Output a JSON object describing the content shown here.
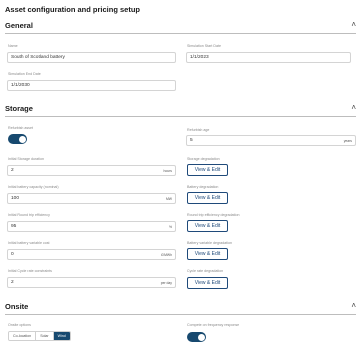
{
  "page": {
    "title": "Asset configuration and pricing setup"
  },
  "general": {
    "title": "General",
    "name_label": "Name",
    "name_value": "South of Scotland battery",
    "start_label": "Simulation Start Date",
    "start_value": "1/1/2023",
    "end_label": "Simulation End Date",
    "end_value": "1/1/2030"
  },
  "storage": {
    "title": "Storage",
    "refurbish_label": "Refurbish asset",
    "refurbish_age_label": "Refurbish age",
    "refurbish_age_value": "5",
    "refurbish_age_unit": "years",
    "duration_label": "Initial Storage duration",
    "duration_value": "2",
    "duration_unit": "hours",
    "degradation_label": "Storage degradation",
    "capacity_label": "Initial battery capacity (nominal)",
    "capacity_value": "100",
    "capacity_unit": "MW",
    "battery_deg_label": "Battery degradation",
    "efficiency_label": "Initial Round trip efficiency",
    "efficiency_value": "95",
    "efficiency_unit": "%",
    "efficiency_deg_label": "Round trip efficiency degradation",
    "variable_cost_label": "Initial battery variable cost",
    "variable_cost_value": "0",
    "variable_cost_unit": "£/MWh",
    "variable_deg_label": "Battery variable degradation",
    "cycle_label": "Initial Cycle rate constraints",
    "cycle_value": "2",
    "cycle_unit": "per day",
    "cycle_deg_label": "Cycle rate degradation",
    "view_edit_label": "View & Edit"
  },
  "onsite": {
    "title": "Onsite",
    "options_label": "Onsite options",
    "options": [
      "Co-location",
      "Solar",
      "Wind"
    ],
    "selected": "Wind",
    "frequency_label": "Compete on frequency response"
  },
  "icons": {
    "collapse": "chevron-up-icon"
  },
  "colors": {
    "accent": "#17496f"
  }
}
